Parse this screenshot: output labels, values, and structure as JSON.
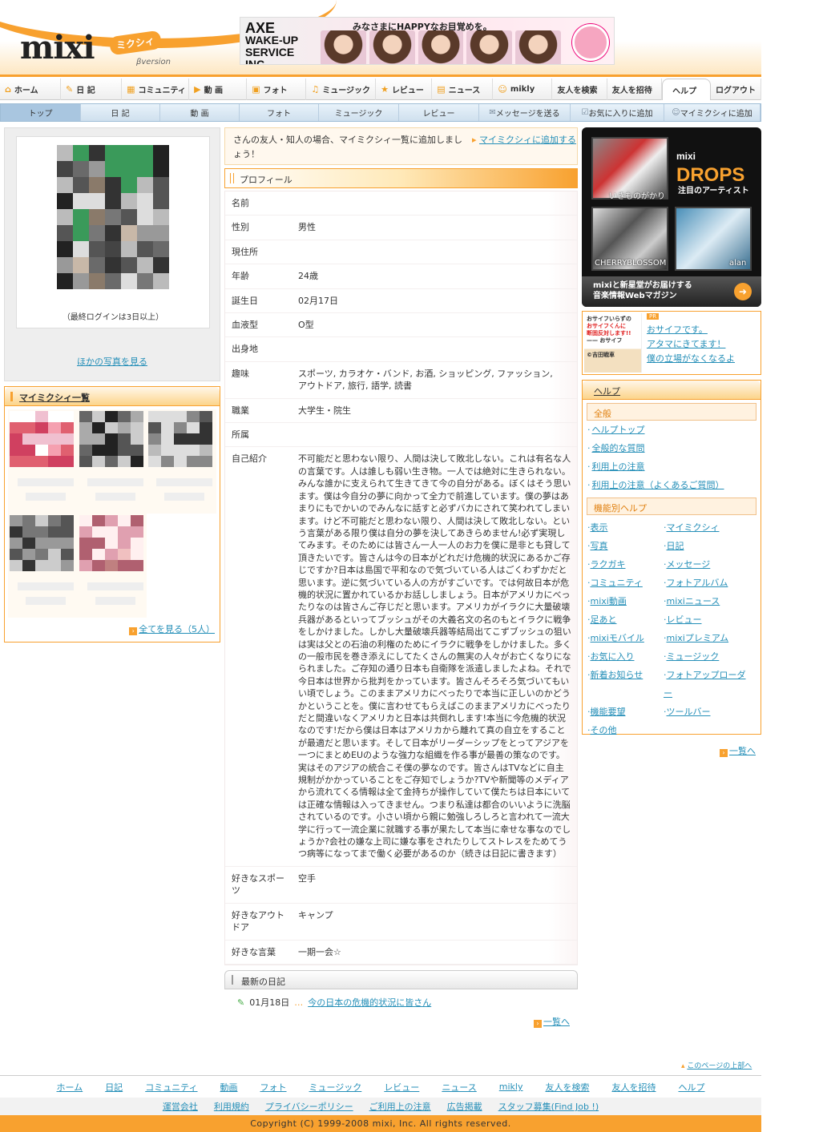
{
  "header": {
    "logo": "mixi",
    "logo_kana": "ミクシィ",
    "logo_beta": "βversion",
    "ad": {
      "brand": "AXE",
      "line1": "WAKE-UP",
      "line2": "SERVICE INC.",
      "copy": "みなさまにHAPPYなお目覚めを。"
    }
  },
  "global_nav": [
    "ホーム",
    "日 記",
    "コミュニティ",
    "動 画",
    "フォト",
    "ミュージック",
    "レビュー",
    "ニュース",
    "mikly",
    "友人を検索",
    "友人を招待",
    "ヘルプ",
    "ログアウト"
  ],
  "sub_nav": [
    "トップ",
    "日 記",
    "動 画",
    "フォト",
    "ミュージック",
    "レビュー",
    "メッセージを送る",
    "お気に入りに追加",
    "マイミクシィに追加"
  ],
  "left": {
    "last_login": "（最終ログインは3日以上）",
    "more_photos": "ほかの写真を見る",
    "mymixi_title": "マイミクシィ一覧",
    "see_all": "全てを見る（5人）"
  },
  "center": {
    "add_message": "さんの友人・知人の場合、マイミクシィ一覧に追加しましょう！",
    "add_action": "マイミクシィに追加する",
    "profile_title": "プロフィール",
    "profile": [
      {
        "k": "名前",
        "v": ""
      },
      {
        "k": "性別",
        "v": "男性"
      },
      {
        "k": "現住所",
        "v": ""
      },
      {
        "k": "年齢",
        "v": "24歳"
      },
      {
        "k": "誕生日",
        "v": "02月17日"
      },
      {
        "k": "血液型",
        "v": "O型"
      },
      {
        "k": "出身地",
        "v": ""
      },
      {
        "k": "趣味",
        "v": "スポーツ, カラオケ・バンド, お酒, ショッピング, ファッション, アウトドア, 旅行, 語学, 読書"
      },
      {
        "k": "職業",
        "v": "大学生・院生"
      },
      {
        "k": "所属",
        "v": ""
      },
      {
        "k": "自己紹介",
        "v": "不可能だと思わない限り、人間は決して敗北しない。これは有名な人の言葉です。人は誰しも弱い生き物。一人では絶対に生きられない。みんな誰かに支えられて生きてきて今の自分がある。ぼくはそう思います。僕は今自分の夢に向かって全力で前進しています。僕の夢はあまりにもでかいのでみんなに話すと必ずバカにされて笑われてしまいます。けど不可能だと思わない限り、人間は決して敗北しない。という言葉がある限り僕は自分の夢を決してあきらめません!必ず実現してみます。そのためには皆さん一人一人のお力を僕に是非とも貸して頂きたいです。皆さんは今の日本がどれだけ危機的状況にあるかご存じですか?日本は島国で平和なので気づいている人はごくわずかだと思います。逆に気づいている人の方がすごいです。では何故日本が危機的状況に置かれているかお話ししましょう。日本がアメリカにべったりなのは皆さんご存じだと思います。アメリカがイラクに大量破壊兵器があるといってブッシュがその大義名文の名のもとイラクに戦争をしかけました。しかし大量破壊兵器等結局出てこずブッシュの狙いは実は父との石油の利権のためにイラクに戦争をしかけました。多くの一般市民を巻き添えにしてたくさんの無実の人々がお亡くなりになられました。ご存知の通り日本も自衛隊を派遣しましたよね。それで今日本は世界から批判をかっています。皆さんそろそろ気づいてもいい頃でしょう。このままアメリカにべったりで本当に正しいのかどうかということを。僕に言わせてもらえばこのままアメリカにべったりだと間違いなくアメリカと日本は共倒れします!本当に今危機的状況なのです!だから僕は日本はアメリカから離れて真の自立をすることが最適だと思います。そして日本がリーダーシップをとってアジアを一つにまとめEUのような強力な組織を作る事が最善の策なのです。実はそのアジアの統合こそ僕の夢なのです。皆さんはTVなどに自主規制がかかっていることをご存知でしょうか?TVや新聞等のメディアから流れてくる情報は全て金持ちが操作していて僕たちは日本にいては正確な情報は入ってきません。つまり私達は都合のいいように洗脳されているのです。小さい頃から親に勉強しろしろと言われて一流大学に行って一流企業に就職する事が果たして本当に幸せな事なのでしょうか?会社の嫌な上司に嫌な事をされたりしてストレスをためてうつ病等になってまで働く必要があるのか（続きは日記に書きます）"
      },
      {
        "k": "好きなスポーツ",
        "v": "空手"
      },
      {
        "k": "好きなアウトドア",
        "v": "キャンプ"
      },
      {
        "k": "好きな言葉",
        "v": "一期一会☆"
      }
    ],
    "diary_title": "最新の日記",
    "diary_date": "01月18日",
    "diary_entry": "今の日本の危機的状況に皆さん",
    "diary_all": "一覧へ"
  },
  "right": {
    "drops": {
      "brand": "mixi",
      "title": "DROPS",
      "sub": "注目のアーティスト",
      "a1": "いきものがかり",
      "a2": "CHERRYBLOSSOM",
      "a3": "alan",
      "band1": "mixiと新星堂がお届けする",
      "band2": "音楽情報Webマガジン"
    },
    "pr": {
      "tag": "PR",
      "img1": "おサイフいらずの",
      "img2": "おサイフくんに",
      "img3": "断固反対します!!",
      "img4": "—— おサイフ",
      "img5": "©吉田戦車",
      "l1": "おサイフです。",
      "l2": "アタマにきてます！",
      "l3": "僕の立場がなくなるよ"
    },
    "help_title": "ヘルプ",
    "cat1": "全般",
    "cat1_links": [
      "ヘルプトップ",
      "全般的な質問",
      "利用上の注意",
      "利用上の注意（よくあるご質問）"
    ],
    "cat2": "機能別ヘルプ",
    "cat2_links": [
      "表示",
      "マイミクシィ",
      "写真",
      "日記",
      "ラクガキ",
      "メッセージ",
      "コミュニティ",
      "フォトアルバム",
      "mixi動画",
      "mixiニュース",
      "足あと",
      "レビュー",
      "mixiモバイル",
      "mixiプレミアム",
      "お気に入り",
      "ミュージック",
      "新着お知らせ",
      "フォトアップローダー",
      "機能要望",
      "ツールバー",
      "その他"
    ],
    "help_all": "一覧へ"
  },
  "footer": {
    "page_top": "このページの上部へ",
    "nav1": [
      "ホーム",
      "日記",
      "コミュニティ",
      "動画",
      "フォト",
      "ミュージック",
      "レビュー",
      "ニュース",
      "mikly",
      "友人を検索",
      "友人を招待",
      "ヘルプ"
    ],
    "nav2": [
      "運営会社",
      "利用規約",
      "プライバシーポリシー",
      "ご利用上の注意",
      "広告掲載",
      "スタッフ募集(Find Job !)"
    ],
    "copyright": "Copyright (C) 1999-2008 mixi, Inc. All rights reserved."
  },
  "colors": {
    "accent": "#f8a12f",
    "link": "#258fb8",
    "subnav": "#cfe0ee"
  },
  "icons": [
    "home-icon",
    "pencil-icon",
    "community-icon",
    "video-icon",
    "photo-icon",
    "music-icon",
    "star-icon",
    "news-icon",
    "mikly-icon"
  ]
}
